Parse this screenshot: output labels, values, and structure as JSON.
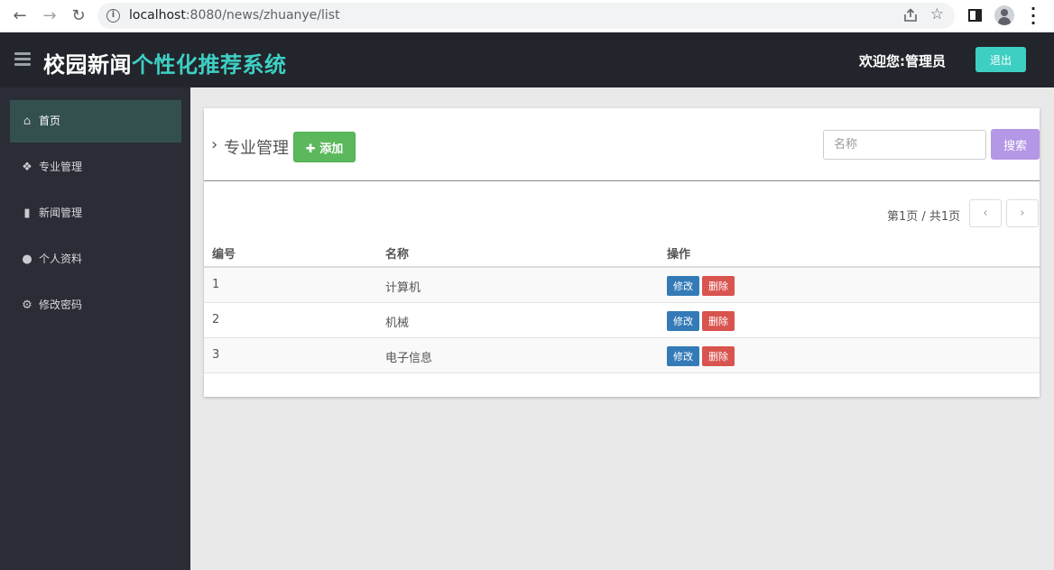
{
  "browser": {
    "url_host": "localhost",
    "url_rest": ":8080/news/zhuanye/list",
    "back_icon": "back-arrow-icon",
    "forward_icon": "forward-arrow-icon",
    "reload_icon": "reload-icon"
  },
  "header": {
    "brand_main": "校园新闻",
    "brand_accent": "个性化推荐系统",
    "welcome": "欢迎您:管理员",
    "logout_label": "退出",
    "accent_color": "#3ecfc3"
  },
  "sidebar": {
    "items": [
      {
        "label": "首页",
        "icon": "home-icon"
      },
      {
        "label": "专业管理",
        "icon": "cubes-icon"
      },
      {
        "label": "新闻管理",
        "icon": "book-icon"
      },
      {
        "label": "个人资料",
        "icon": "user-icon"
      },
      {
        "label": "修改密码",
        "icon": "gears-icon"
      }
    ]
  },
  "main": {
    "title": "专业管理",
    "add_label": "添加",
    "search_placeholder": "名称",
    "search_label": "搜索",
    "pager_text": "第1页 / 共1页",
    "columns": [
      "编号",
      "名称",
      "操作"
    ],
    "rows": [
      {
        "id": "1",
        "name": "计算机"
      },
      {
        "id": "2",
        "name": "机械"
      },
      {
        "id": "3",
        "name": "电子信息"
      }
    ],
    "edit_label": "修改",
    "delete_label": "删除"
  }
}
